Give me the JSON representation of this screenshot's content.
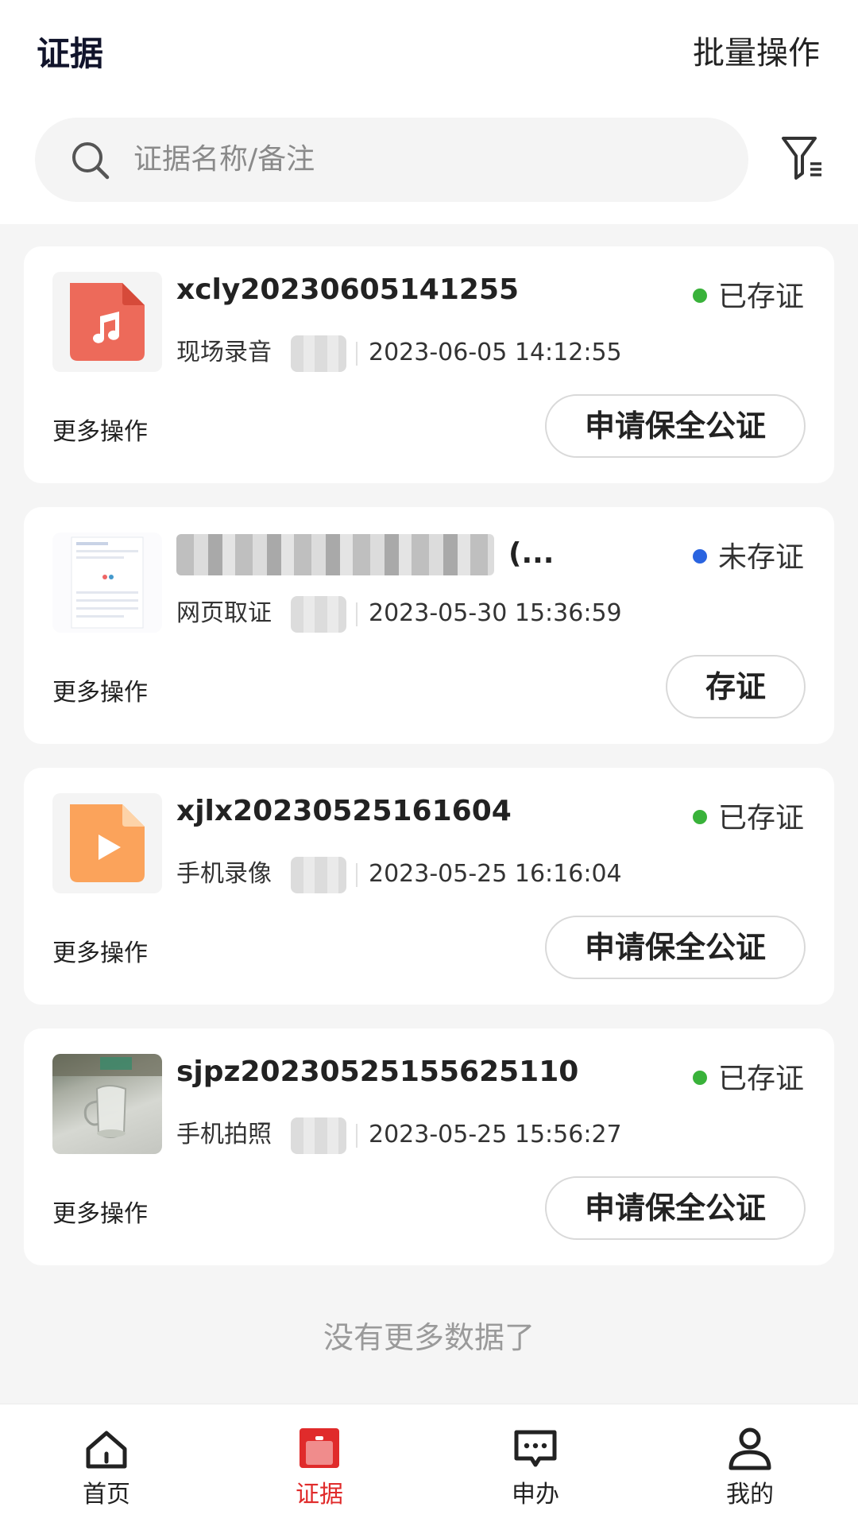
{
  "header": {
    "title": "证据",
    "batch_label": "批量操作"
  },
  "search": {
    "placeholder": "证据名称/备注",
    "value": ""
  },
  "records": [
    {
      "name": "xcly20230605141255",
      "status": "已存证",
      "status_color": "#39b23a",
      "type": "现场录音",
      "datetime": "2023-06-05 14:12:55",
      "thumb_icon": "audio-file-icon",
      "more_label": "更多操作",
      "action_label": "申请保全公证"
    },
    {
      "name": "(...",
      "status": "未存证",
      "status_color": "#2a64e0",
      "type": "网页取证",
      "datetime": "2023-05-30 15:36:59",
      "thumb_icon": "webpage-screenshot-thumbnail",
      "more_label": "更多操作",
      "action_label": "存证"
    },
    {
      "name": "xjlx20230525161604",
      "status": "已存证",
      "status_color": "#39b23a",
      "type": "手机录像",
      "datetime": "2023-05-25 16:16:04",
      "thumb_icon": "video-file-icon",
      "more_label": "更多操作",
      "action_label": "申请保全公证"
    },
    {
      "name": "sjpz20230525155625110",
      "status": "已存证",
      "status_color": "#39b23a",
      "type": "手机拍照",
      "datetime": "2023-05-25 15:56:27",
      "thumb_icon": "photo-thumbnail",
      "more_label": "更多操作",
      "action_label": "申请保全公证"
    }
  ],
  "no_more_text": "没有更多数据了",
  "tabbar": {
    "tabs": [
      {
        "label": "首页",
        "icon": "home-icon"
      },
      {
        "label": "证据",
        "icon": "evidence-icon",
        "active": true
      },
      {
        "label": "申办",
        "icon": "message-icon"
      },
      {
        "label": "我的",
        "icon": "user-icon"
      }
    ],
    "active_color": "#e02b2b"
  }
}
